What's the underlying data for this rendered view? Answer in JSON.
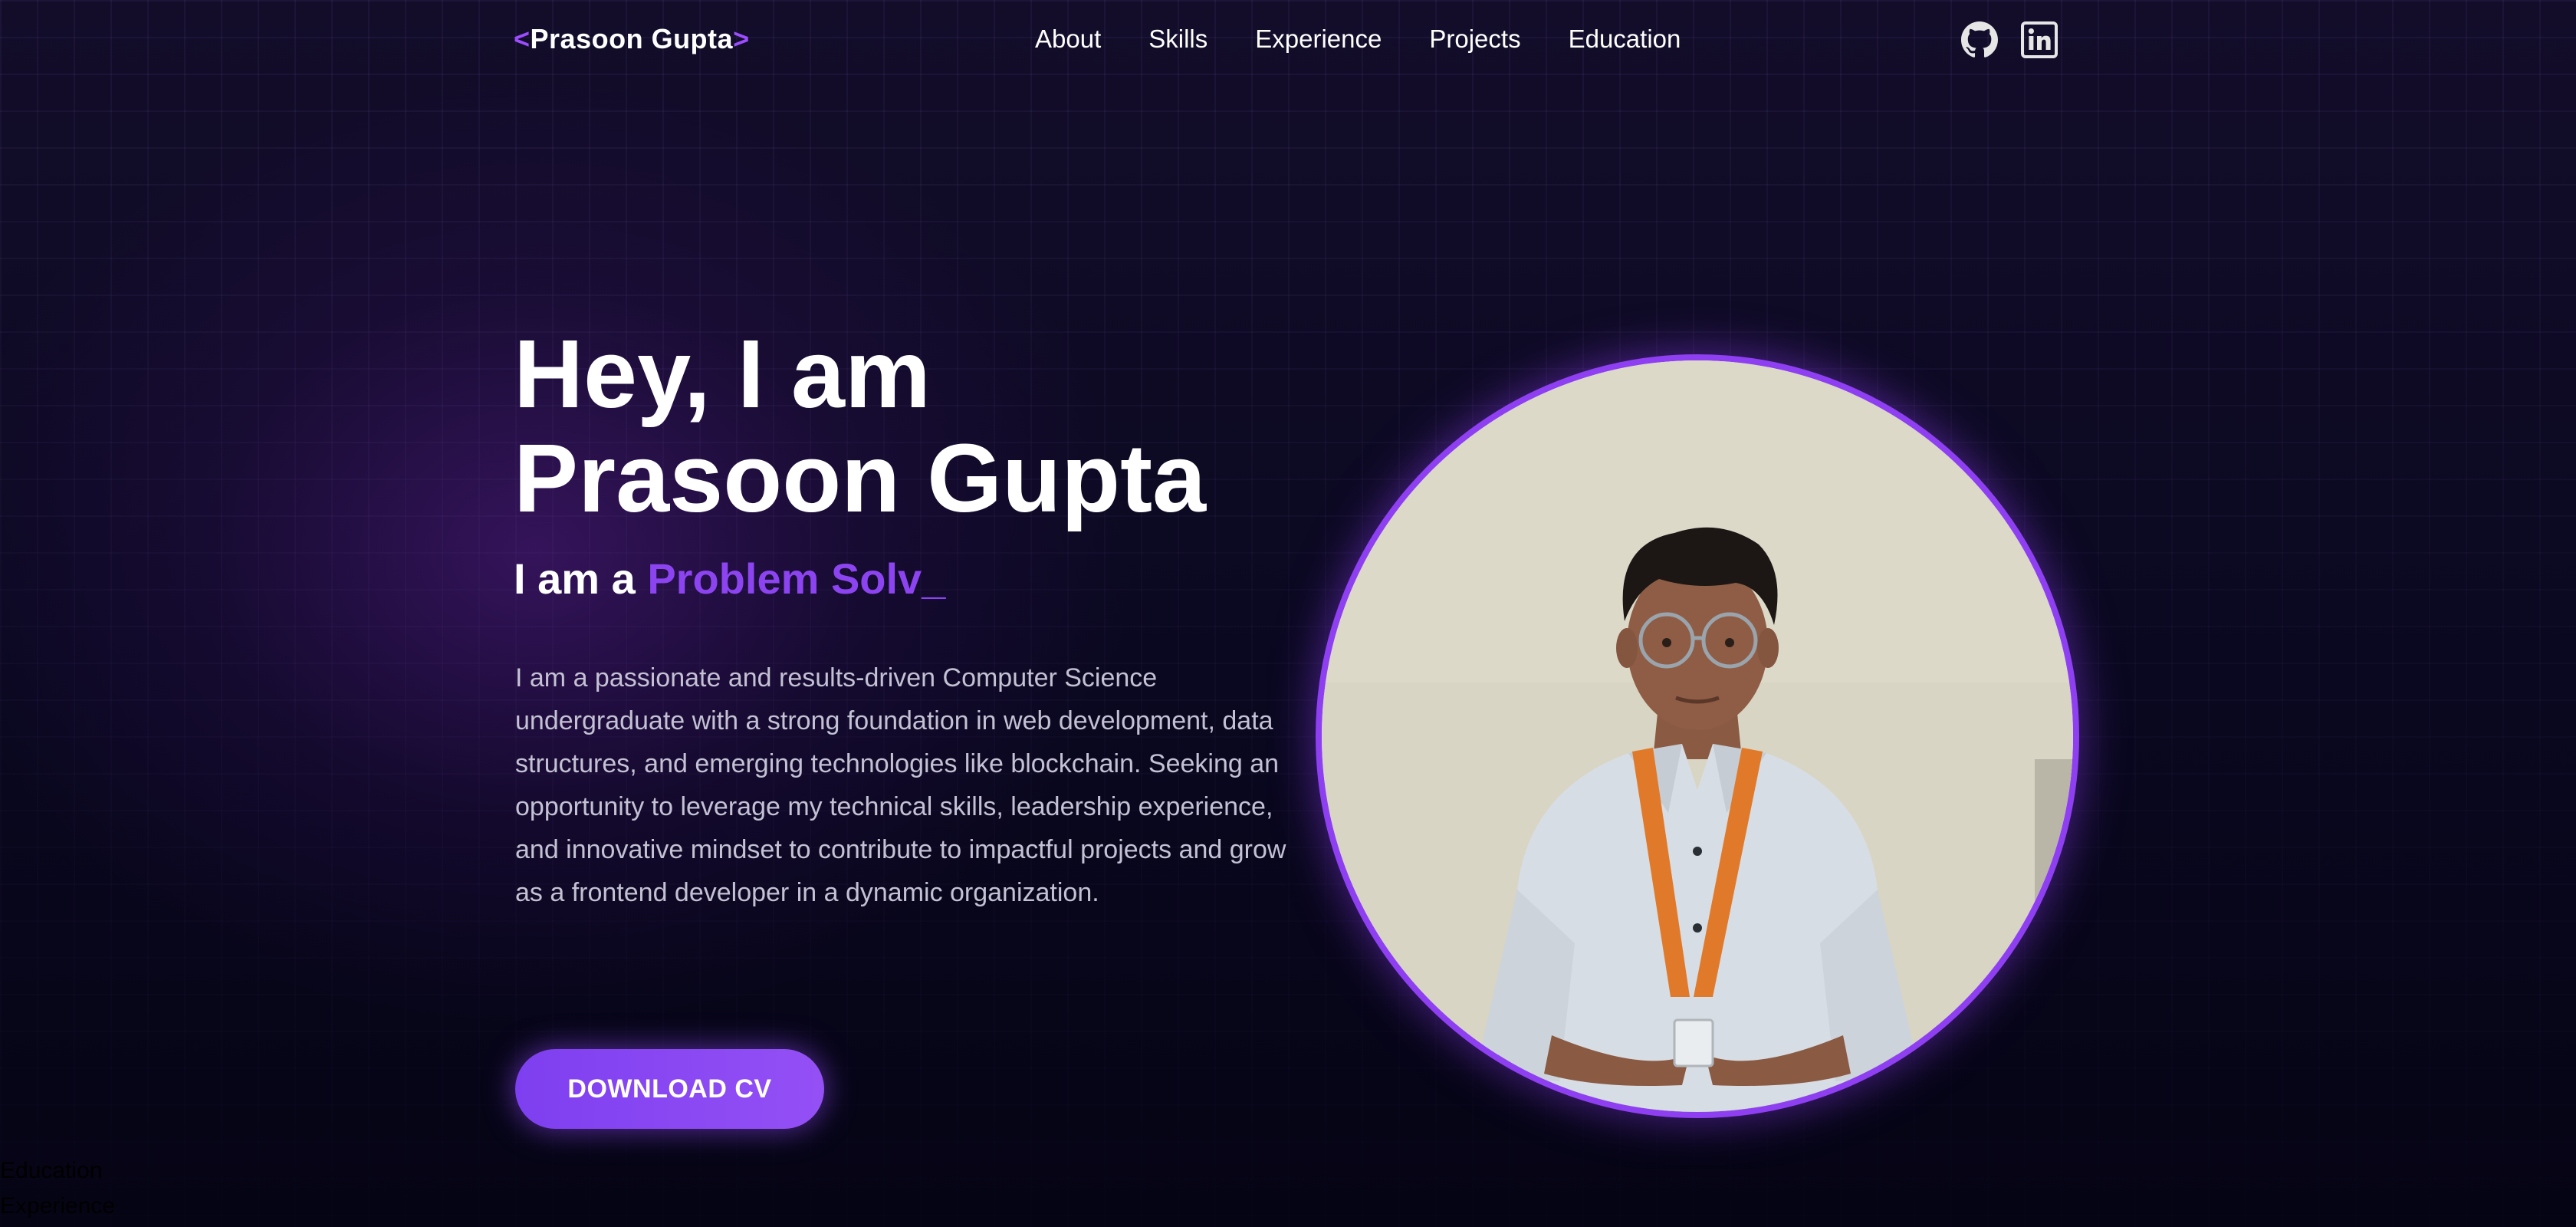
{
  "nav": {
    "logo_open": "<",
    "logo_name": "Prasoon Gupta",
    "logo_close": ">",
    "links": [
      "About",
      "Skills",
      "Experience",
      "Projects",
      "Education"
    ],
    "social": [
      "github-icon",
      "linkedin-icon"
    ]
  },
  "hero": {
    "title_line1": "Hey, I am",
    "title_line2": "Prasoon Gupta",
    "subtitle_prefix": "I am a ",
    "subtitle_role": "Problem Solv",
    "subtitle_cursor": "_",
    "bio": "I am a passionate and results-driven Computer Science undergraduate with a strong foundation in web development, data structures, and emerging technologies like blockchain. Seeking an opportunity to leverage my technical skills, leadership experience, and innovative mindset to contribute to impactful projects and grow as a frontend developer in a dynamic organization.",
    "cv_button": "DOWNLOAD CV"
  },
  "stray": {
    "line1": "Education",
    "line2": "Experience"
  },
  "colors": {
    "accent": "#8c44f0",
    "background": "#08061a",
    "text": "#ffffff",
    "muted_text": "#c3c1d3"
  }
}
